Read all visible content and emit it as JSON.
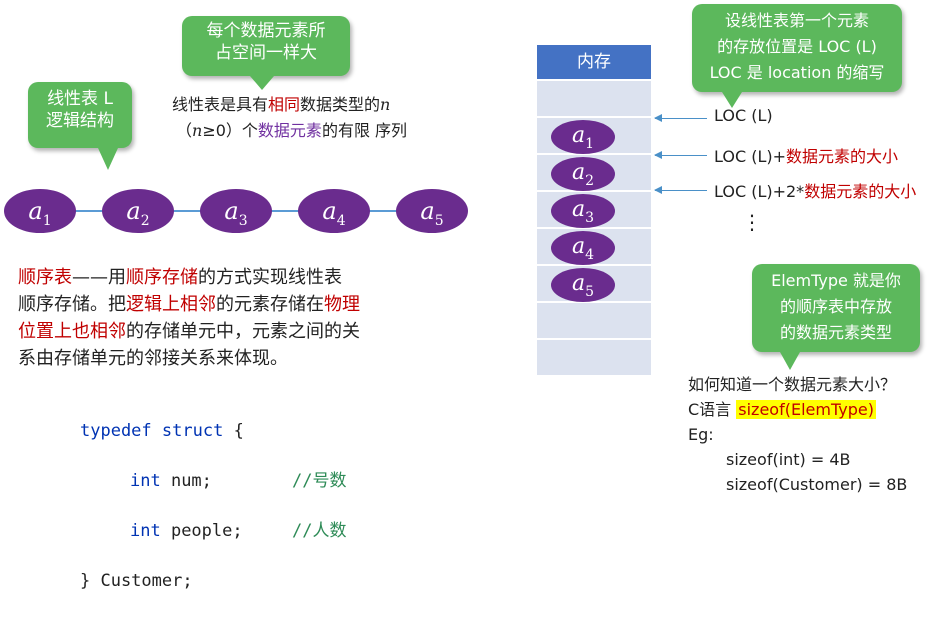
{
  "bubbles": {
    "element_size": "每个数据元素所\n占空间一样大",
    "logical": "线性表 L\n逻辑结构",
    "loc_def": "设线性表第一个元素\n的存放位置是 LOC (L)\nLOC 是 location 的缩写",
    "elemtype": "ElemType 就是你\n的顺序表中存放\n的数据元素类型"
  },
  "definition": {
    "p1": "线性表是具有",
    "p2": "相同",
    "p3": "数据类型的",
    "p4": "n",
    "p5": "（",
    "p6": "n",
    "p7": "≥0）个",
    "p8": "数据元素",
    "p9": "的有限 序列"
  },
  "nodes": {
    "letter": "a",
    "subs": [
      "1",
      "2",
      "3",
      "4",
      "5"
    ]
  },
  "seq_list": {
    "title": "顺序表",
    "dash": "——用",
    "storage": "顺序存储",
    "rest": "的方式实现线性表",
    "l2": "顺序存储。把",
    "logical_adj": "逻辑上相邻",
    "l2b": "的元素存储在",
    "physical": "物理",
    "physical2": "位置上也相邻",
    "l3b": "的存储单元中，元素之间的关",
    "l4": "系由存储单元的邻接关系来体现。"
  },
  "code": {
    "l1a": "typedef",
    "l1b": " ",
    "l1c": "struct",
    "l1d": " {",
    "l2a": "int",
    "l2b": " num;",
    "l2c": "//号数",
    "l3a": "int",
    "l3b": " people;",
    "l3c": "//人数",
    "l4": "} Customer;"
  },
  "memory": {
    "header": "内存"
  },
  "loc": {
    "l1": "LOC (L)",
    "l2a": "LOC (L)+",
    "l2b": "数据元素的大小",
    "l3a": "LOC (L)+2*",
    "l3b": "数据元素的大小",
    "dots": "⋮"
  },
  "size_q": {
    "q": "如何知道一个数据元素大小？",
    "c_lang": "C语言 ",
    "sizeof": "sizeof(ElemType)",
    "eg": "Eg:",
    "e1": "sizeof(int) = 4B",
    "e2": "sizeof(Customer) = 8B"
  },
  "colors": {
    "green": "#5cb85c",
    "purple": "#6a2c8e",
    "header_blue": "#4472c4",
    "cell": "#dce2ef",
    "red": "#c00000",
    "highlight": "#ffff00"
  }
}
